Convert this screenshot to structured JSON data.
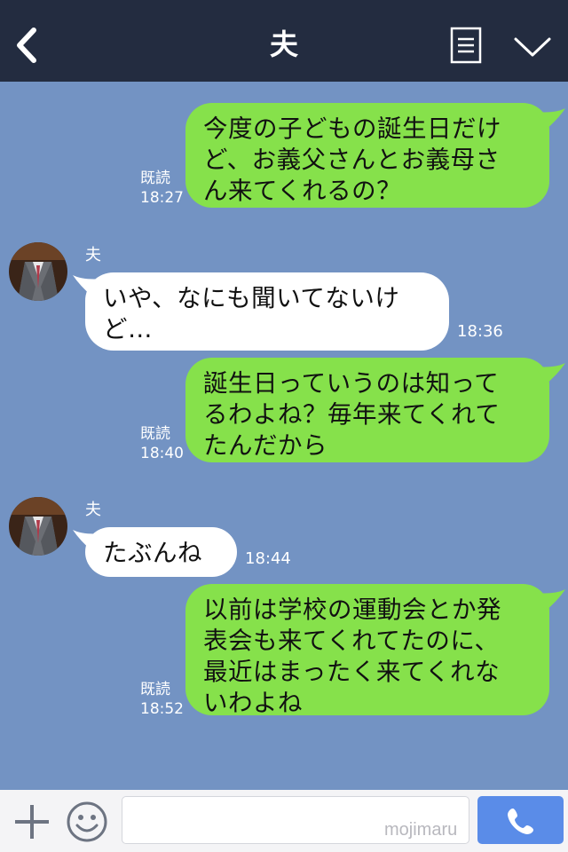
{
  "header": {
    "title": "夫"
  },
  "messages": [
    {
      "direction": "out",
      "text": "今度の子どもの誕生日だけ\nど、お義父さんとお義母さ\nん来てくれるの？",
      "read": "既読",
      "time": "18:27"
    },
    {
      "direction": "in",
      "sender": "夫",
      "text": "いや、なにも聞いてないけ\nど…",
      "time": "18:36"
    },
    {
      "direction": "out",
      "text": "誕生日っていうのは知って\nるわよね？毎年来てくれて\nたんだから",
      "read": "既読",
      "time": "18:40"
    },
    {
      "direction": "in",
      "sender": "夫",
      "text": "たぶんね",
      "time": "18:44"
    },
    {
      "direction": "out",
      "text": "以前は学校の運動会とか発\n表会も来てくれてたのに、\n最近はまったく来てくれな\nいわよね",
      "read": "既読",
      "time": "18:52"
    }
  ],
  "footer": {
    "watermark": "mojimaru"
  },
  "colors": {
    "header_bg": "#232c40",
    "chat_bg": "#7393c3",
    "outgoing_bubble": "#86e14b",
    "incoming_bubble": "#ffffff",
    "call_button": "#5a8ce8"
  },
  "icons": {
    "back": "chevron-left-icon",
    "menu": "document-list-icon",
    "collapse": "chevron-down-icon",
    "add": "plus-icon",
    "emoji": "smiley-icon",
    "call": "phone-icon"
  }
}
